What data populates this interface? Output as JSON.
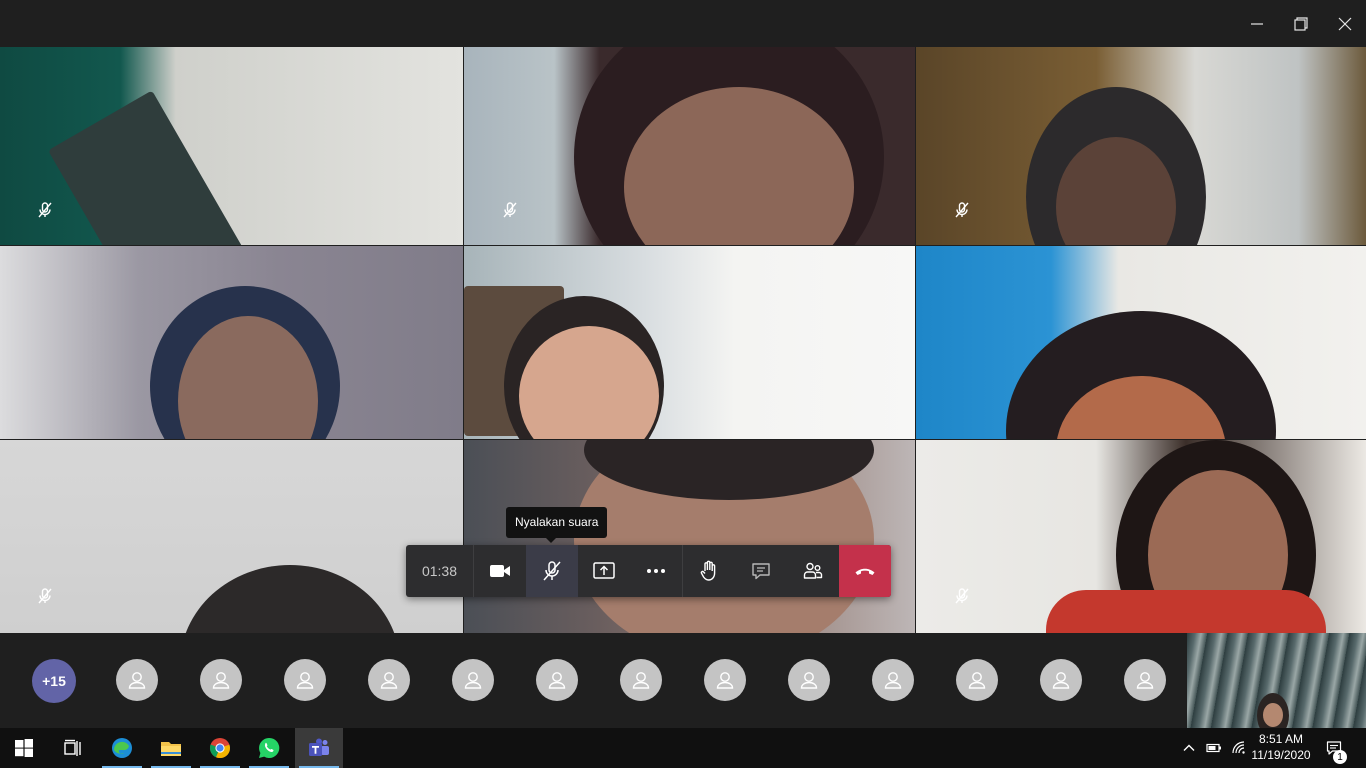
{
  "window": {
    "minimize_icon": "minimize-icon",
    "restore_icon": "restore-icon",
    "close_icon": "close-icon"
  },
  "video_tiles": [
    {
      "muted": true
    },
    {
      "muted": true
    },
    {
      "muted": true
    },
    {
      "muted": true
    },
    {
      "muted": true
    },
    {
      "muted": true
    },
    {
      "muted": true
    },
    {
      "muted": false
    },
    {
      "muted": true
    }
  ],
  "toolbar": {
    "timer": "01:38",
    "tooltip": "Nyalakan suara",
    "buttons": [
      "camera-icon",
      "mic-off-icon",
      "share-screen-icon",
      "more-options-icon",
      "raise-hand-icon",
      "chat-icon",
      "participants-icon",
      "hang-up-icon"
    ],
    "hangup_color": "#c4314b"
  },
  "participants_strip": {
    "overflow_count": "+15",
    "overflow_color": "#6264a7",
    "avatar_count": 13
  },
  "taskbar": {
    "apps": [
      "windows-start-icon",
      "task-view-icon",
      "edge-icon",
      "file-explorer-icon",
      "chrome-icon",
      "whatsapp-icon",
      "teams-icon"
    ],
    "time": "8:51 AM",
    "date": "11/19/2020",
    "notification_count": "1"
  }
}
